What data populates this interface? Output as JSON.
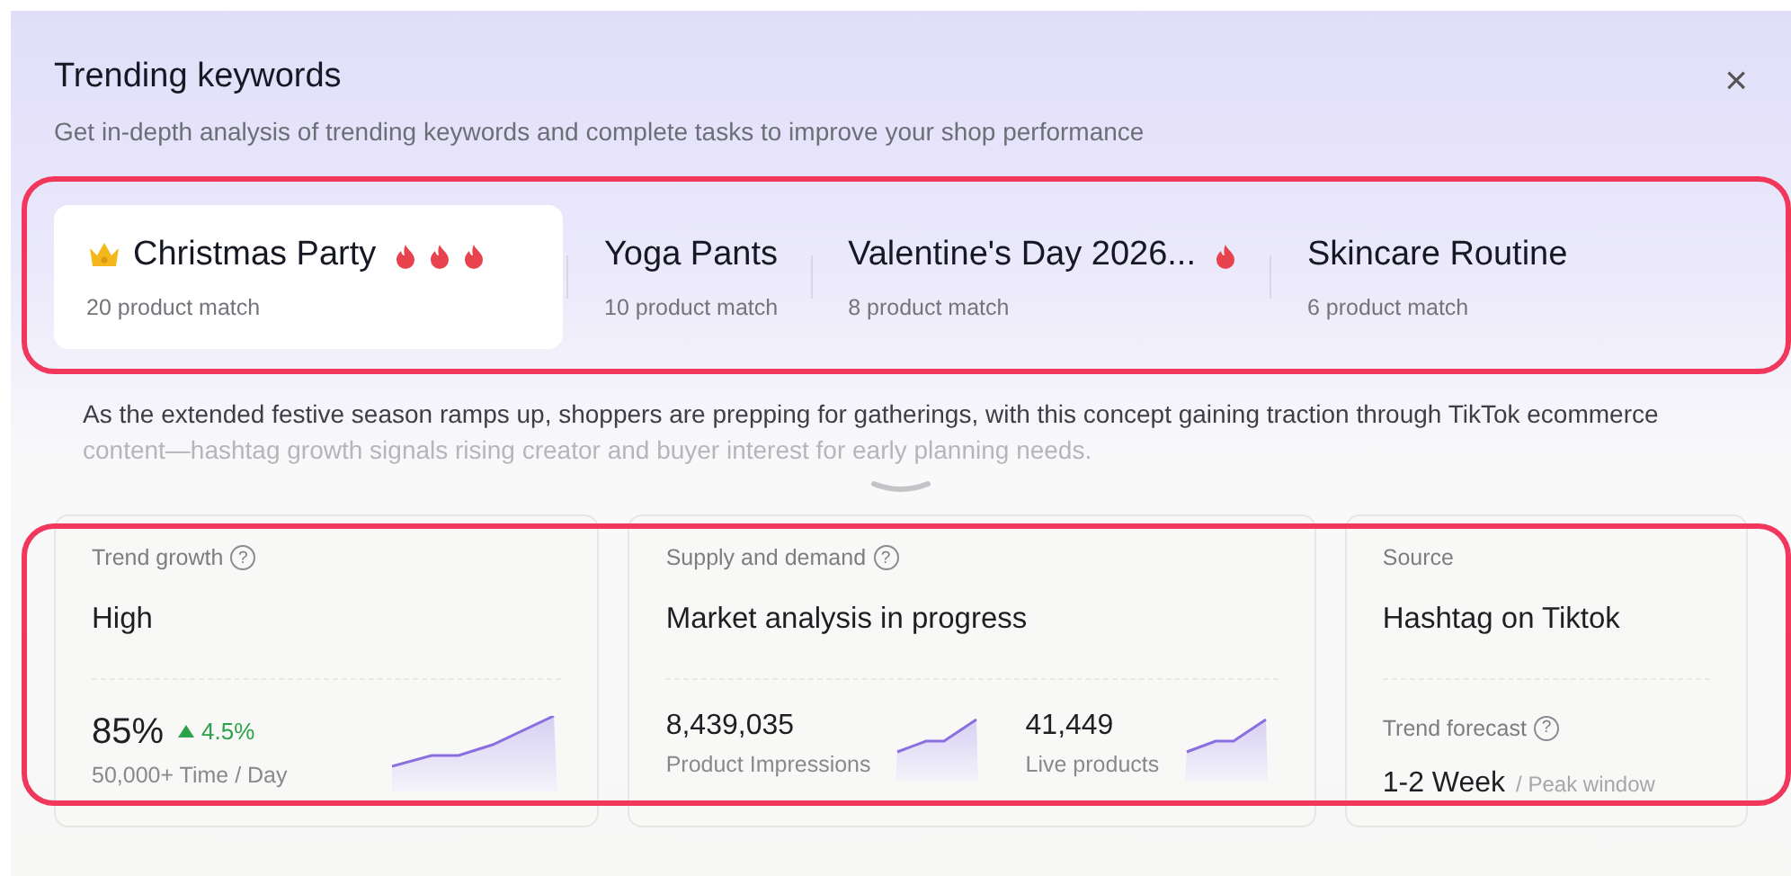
{
  "dialog": {
    "title": "Trending keywords",
    "subtitle": "Get in-depth analysis of trending keywords and complete tasks to improve your shop performance",
    "close": "×"
  },
  "keywords": [
    {
      "title": "Christmas Party",
      "subtitle": "20 product match",
      "selected": true,
      "top_ranked": true,
      "flames": [
        {
          "kind": "flame"
        },
        {
          "kind": "flame"
        },
        {
          "kind": "flame"
        }
      ]
    },
    {
      "title": "Yoga Pants",
      "subtitle": "10 product match",
      "selected": false,
      "top_ranked": false
    },
    {
      "title": "Valentine's Day 2026...",
      "subtitle": "8 product match",
      "selected": false,
      "top_ranked": false,
      "flames": [
        {
          "kind": "flame"
        }
      ]
    },
    {
      "title": "Skincare Routine",
      "subtitle": "6 product match",
      "selected": false,
      "top_ranked": false
    }
  ],
  "description": {
    "text": "As the extended festive season ramps up, shoppers are prepping for gatherings, with this concept gaining traction through TikTok ecommerce",
    "faded_text": "content—hashtag growth signals rising creator and buyer interest for early planning needs.",
    "expanded": false
  },
  "cards": [
    {
      "kind": "growth",
      "label": "Trend growth",
      "help": "?",
      "value": "High",
      "stats": [
        {
          "value": "85%",
          "change": "4.5%",
          "trend_up": true,
          "caption": "50,000+ Time / Day"
        }
      ]
    },
    {
      "kind": "supply",
      "label": "Supply and demand",
      "help": "?",
      "value": "Market analysis in progress",
      "stats": [
        {
          "value": "8,439,035",
          "caption": "Product Impressions"
        },
        {
          "value": "41,449",
          "caption": "Live products"
        }
      ]
    },
    {
      "kind": "source",
      "label": "Source",
      "value": "Hashtag on Tiktok",
      "forecast": {
        "label": "Trend forecast",
        "help": "?",
        "value": "1-2 Week",
        "note": "/ Peak window"
      }
    }
  ]
}
